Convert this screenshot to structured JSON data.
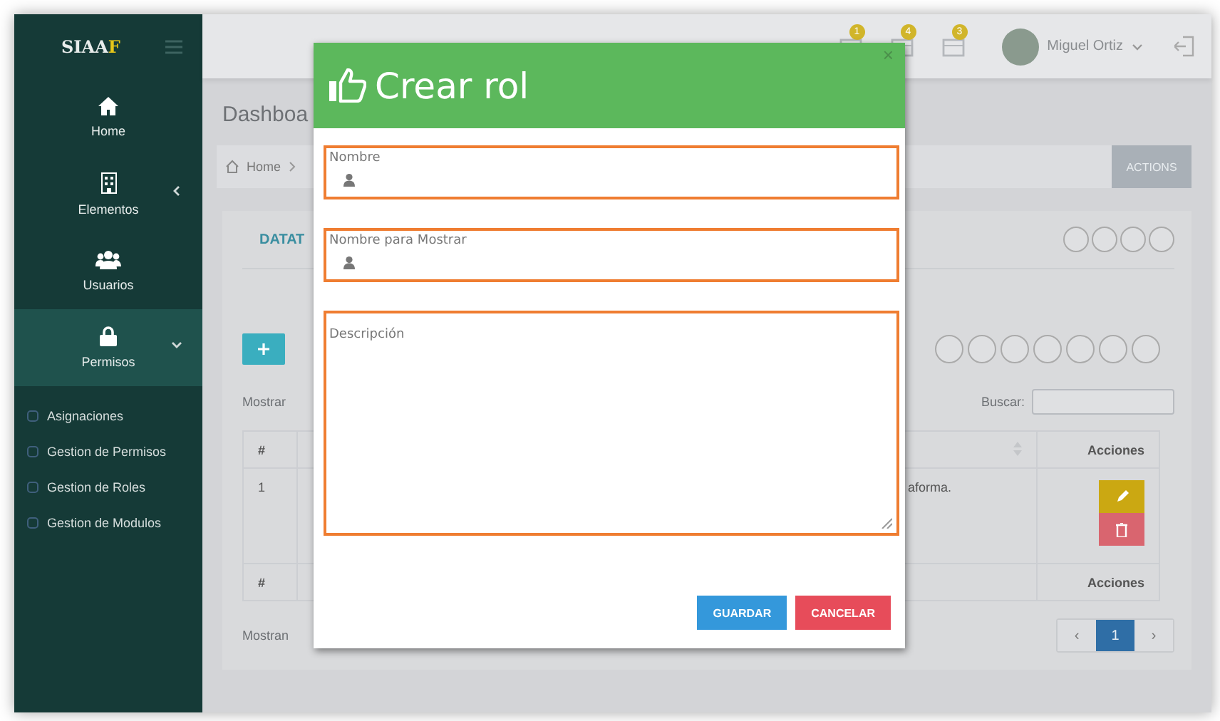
{
  "sidebar": {
    "logo": {
      "text": "SIAA",
      "accent": "F"
    },
    "items": [
      {
        "label": "Home",
        "selected": false
      },
      {
        "label": "Elementos",
        "selected": false,
        "expanded": false
      },
      {
        "label": "Usuarios",
        "selected": false
      },
      {
        "label": "Permisos",
        "selected": true,
        "expanded": true
      }
    ],
    "subitems": [
      "Asignaciones",
      "Gestion de Permisos",
      "Gestion de Roles",
      "Gestion de Modulos"
    ]
  },
  "topbar": {
    "badges": [
      "1",
      "4",
      "3"
    ],
    "user": "Miguel Ortiz"
  },
  "page": {
    "title": "Dashboa",
    "breadcrumb": "Home",
    "actions": "ACTIONS",
    "panel_title": "DATAT",
    "show_label": "Mostrar",
    "search_label": "Buscar:",
    "table": {
      "header": [
        "#",
        "Acciones"
      ],
      "rows": [
        {
          "cells": [
            "1",
            "aforma."
          ]
        }
      ],
      "footer": [
        "#",
        "Acciones"
      ]
    },
    "info": "Mostran",
    "pagination": [
      {
        "label": "‹",
        "selected": false
      },
      {
        "label": "1",
        "selected": true
      },
      {
        "label": "›",
        "selected": false
      }
    ]
  },
  "modal": {
    "title": "Crear rol",
    "close": "×",
    "fields": [
      {
        "label": "Nombre",
        "kind": "text"
      },
      {
        "label": "Nombre para Mostrar",
        "kind": "text"
      },
      {
        "label": "Descripción",
        "kind": "textarea"
      }
    ],
    "buttons": [
      {
        "label": "GUARDAR",
        "kind": "primary"
      },
      {
        "label": "CANCELAR",
        "kind": "danger"
      }
    ]
  }
}
